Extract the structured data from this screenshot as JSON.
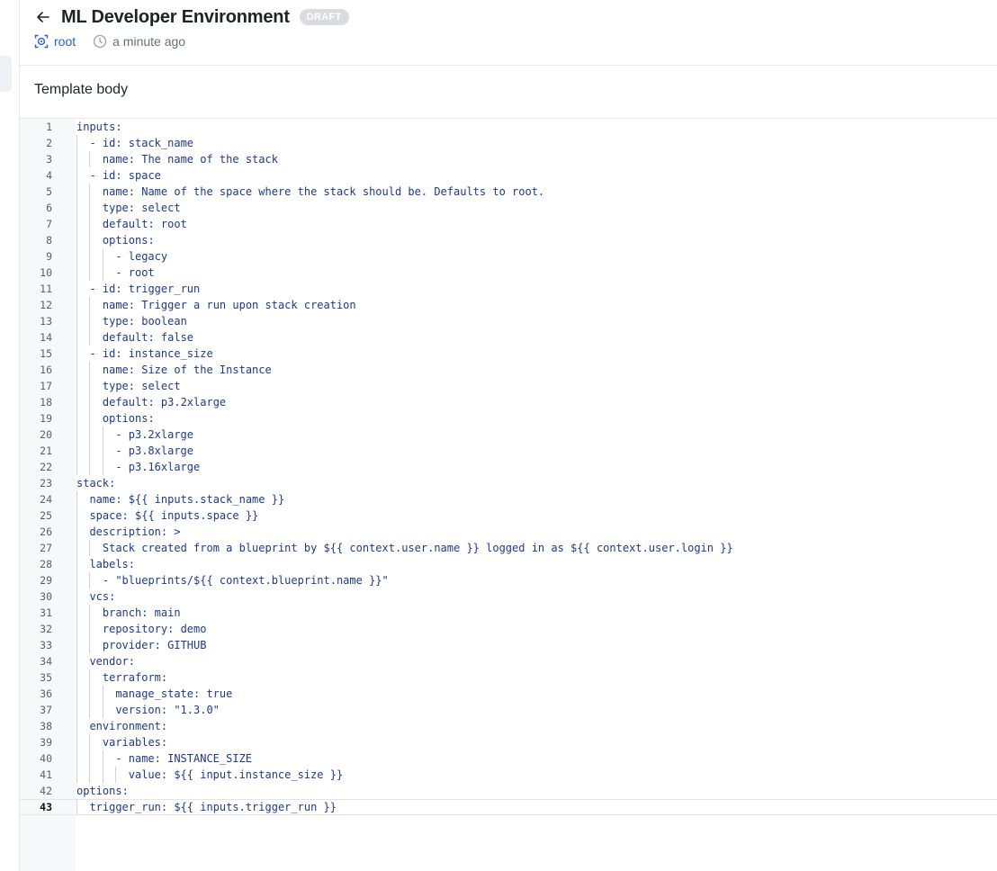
{
  "header": {
    "title": "ML Developer Environment",
    "status_badge": "DRAFT",
    "space": "root",
    "updated": "a minute ago",
    "icons": {
      "back": "arrow-left-icon",
      "space": "space-icon",
      "time": "clock-icon"
    }
  },
  "section": {
    "title": "Template body"
  },
  "editor": {
    "active_line": 43,
    "lines": [
      {
        "n": "1",
        "indent": 0,
        "text": "inputs:"
      },
      {
        "n": "2",
        "indent": 1,
        "text": "- id: stack_name"
      },
      {
        "n": "3",
        "indent": 2,
        "text": "name: The name of the stack"
      },
      {
        "n": "4",
        "indent": 1,
        "text": "- id: space"
      },
      {
        "n": "5",
        "indent": 2,
        "text": "name: Name of the space where the stack should be. Defaults to root."
      },
      {
        "n": "6",
        "indent": 2,
        "text": "type: select"
      },
      {
        "n": "7",
        "indent": 2,
        "text": "default: root"
      },
      {
        "n": "8",
        "indent": 2,
        "text": "options:"
      },
      {
        "n": "9",
        "indent": 3,
        "text": "- legacy"
      },
      {
        "n": "10",
        "indent": 3,
        "text": "- root"
      },
      {
        "n": "11",
        "indent": 1,
        "text": "- id: trigger_run"
      },
      {
        "n": "12",
        "indent": 2,
        "text": "name: Trigger a run upon stack creation"
      },
      {
        "n": "13",
        "indent": 2,
        "text": "type: boolean"
      },
      {
        "n": "14",
        "indent": 2,
        "text": "default: false"
      },
      {
        "n": "15",
        "indent": 1,
        "text": "- id: instance_size"
      },
      {
        "n": "16",
        "indent": 2,
        "text": "name: Size of the Instance"
      },
      {
        "n": "17",
        "indent": 2,
        "text": "type: select"
      },
      {
        "n": "18",
        "indent": 2,
        "text": "default: p3.2xlarge"
      },
      {
        "n": "19",
        "indent": 2,
        "text": "options:"
      },
      {
        "n": "20",
        "indent": 3,
        "text": "- p3.2xlarge"
      },
      {
        "n": "21",
        "indent": 3,
        "text": "- p3.8xlarge"
      },
      {
        "n": "22",
        "indent": 3,
        "text": "- p3.16xlarge"
      },
      {
        "n": "23",
        "indent": 0,
        "text": "stack:"
      },
      {
        "n": "24",
        "indent": 1,
        "text": "name: ${{ inputs.stack_name }}"
      },
      {
        "n": "25",
        "indent": 1,
        "text": "space: ${{ inputs.space }}"
      },
      {
        "n": "26",
        "indent": 1,
        "text": "description: >"
      },
      {
        "n": "27",
        "indent": 2,
        "text": "Stack created from a blueprint by ${{ context.user.name }} logged in as ${{ context.user.login }}"
      },
      {
        "n": "28",
        "indent": 1,
        "text": "labels:"
      },
      {
        "n": "29",
        "indent": 2,
        "text": "- \"blueprints/${{ context.blueprint.name }}\""
      },
      {
        "n": "30",
        "indent": 1,
        "text": "vcs:"
      },
      {
        "n": "31",
        "indent": 2,
        "text": "branch: main"
      },
      {
        "n": "32",
        "indent": 2,
        "text": "repository: demo"
      },
      {
        "n": "33",
        "indent": 2,
        "text": "provider: GITHUB"
      },
      {
        "n": "34",
        "indent": 1,
        "text": "vendor:"
      },
      {
        "n": "35",
        "indent": 2,
        "text": "terraform:"
      },
      {
        "n": "36",
        "indent": 3,
        "text": "manage_state: true"
      },
      {
        "n": "37",
        "indent": 3,
        "text": "version: \"1.3.0\""
      },
      {
        "n": "38",
        "indent": 1,
        "text": "environment:"
      },
      {
        "n": "39",
        "indent": 2,
        "text": "variables:"
      },
      {
        "n": "40",
        "indent": 3,
        "text": "- name: INSTANCE_SIZE"
      },
      {
        "n": "41",
        "indent": 4,
        "text": "value: ${{ input.instance_size }}"
      },
      {
        "n": "42",
        "indent": 0,
        "text": "options:"
      },
      {
        "n": "43",
        "indent": 1,
        "text": "trigger_run: ${{ inputs.trigger_run }}"
      }
    ]
  }
}
